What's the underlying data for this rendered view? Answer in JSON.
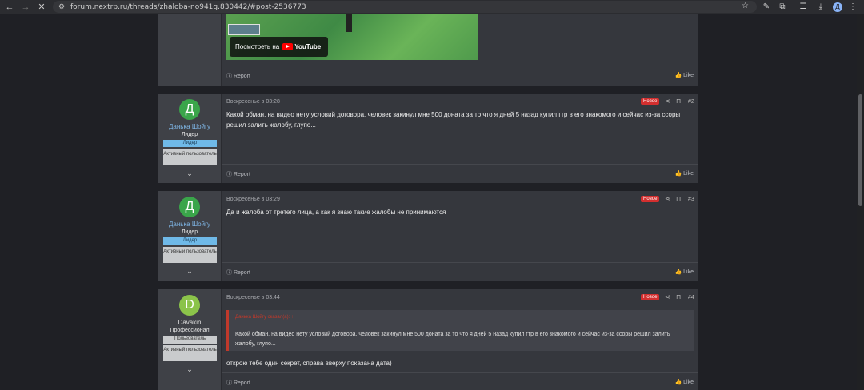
{
  "browser": {
    "url": "forum.nextrp.ru/threads/zhaloba-no941g.830442/#post-2536773",
    "profile_initial": "Д"
  },
  "video": {
    "watch_label": "Посмотреть на",
    "brand": "YouTube"
  },
  "common": {
    "report_label": "Report",
    "like_label": "Like",
    "new_label": "Новое",
    "colors": {
      "new_badge": "#d32f2f",
      "leader_banner": "#6fb9e8",
      "quote_border": "#c0392b"
    }
  },
  "posts": [
    {
      "avatar_letter": "Д",
      "avatar_color": "#3aa54a",
      "username": "Данька Шойгу",
      "user_title": "Лидер",
      "banners": [
        "Лидер",
        "Активный пользователь"
      ],
      "date": "Воскресенье в 03:28",
      "number": "#2",
      "message": "Какой обман, на видео нету условий договора, человек закинул мне 500 доната за то что я дней 5 назад купил гтр в его знакомого и сейчас из-за ссоры решил залить жалобу, глупо..."
    },
    {
      "avatar_letter": "Д",
      "avatar_color": "#3aa54a",
      "username": "Данька Шойгу",
      "user_title": "Лидер",
      "banners": [
        "Лидер",
        "Активный пользователь"
      ],
      "date": "Воскресенье в 03:29",
      "number": "#3",
      "message": "Да и жалоба от третего лица, а как я знаю такие жалобы не принимаются"
    },
    {
      "avatar_letter": "D",
      "avatar_color": "#8bc34a",
      "username": "Davakin",
      "user_title": "Профессионал",
      "banners": [
        "Пользователь",
        "Активный пользователь"
      ],
      "date": "Воскресенье в 03:44",
      "number": "#4",
      "quote_title": "Данька Шойгу сказал(а): ↑",
      "quote": "Какой обман, на видео нету условий договора, человек закинул мне 500 доната за то что я дней 5 назад купил гтр в его знакомого и сейчас из-за ссоры решил залить жалобу, глупо...",
      "message": "открою тебе один секрет, справа вверху показана дата)"
    }
  ]
}
